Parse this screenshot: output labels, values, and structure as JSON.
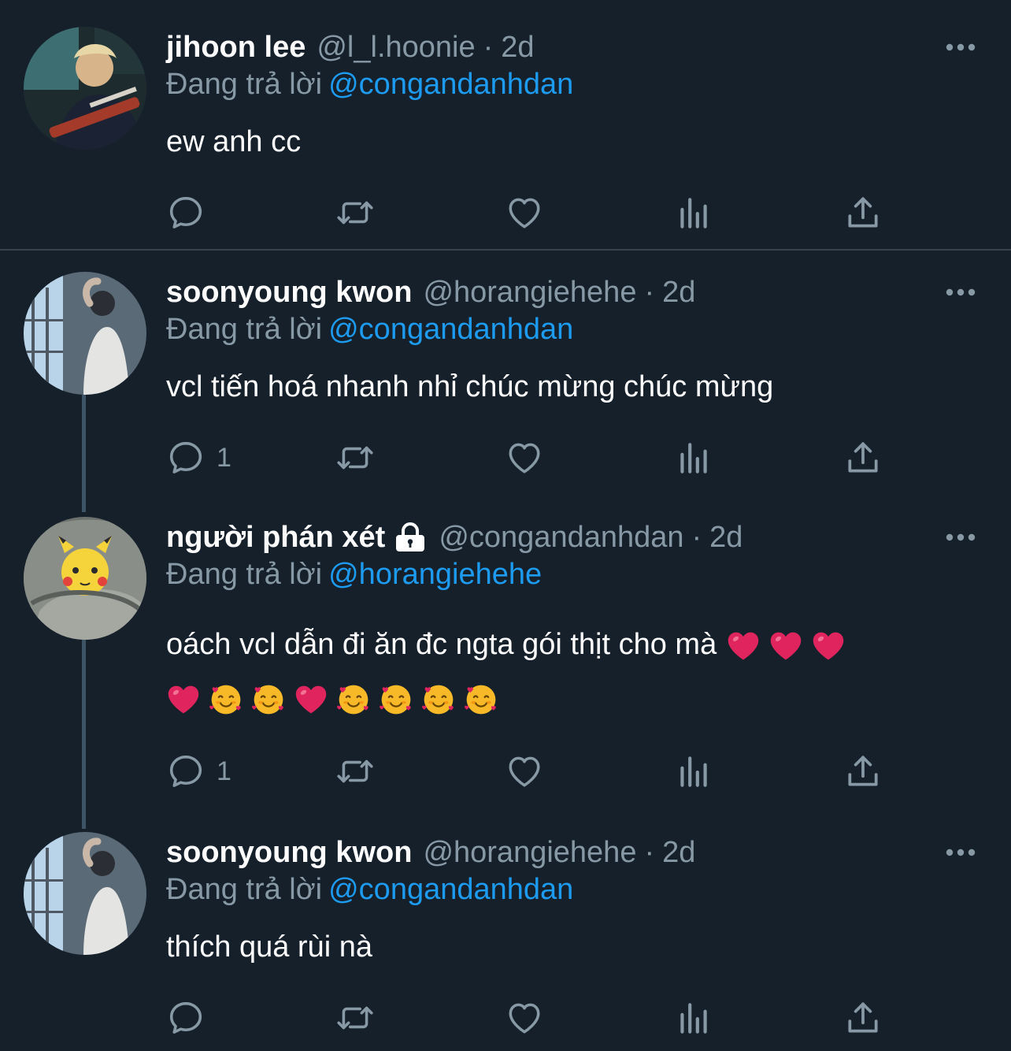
{
  "colors": {
    "background": "#15202b",
    "secondary_text": "#8899a6",
    "mention": "#1d9bf0",
    "heart_emoji": "#e0245e",
    "smile_emoji": "#f7b928"
  },
  "tweets": [
    {
      "name": "jihoon lee",
      "handle": "@l_l.hoonie",
      "dot": "·",
      "time": "2d",
      "reply_prefix": "Đang trả lời",
      "reply_to": "@congandanhdan",
      "text": "ew anh cc",
      "reply_count": "",
      "icons": [
        "reply-icon",
        "retweet-icon",
        "like-icon",
        "analytics-icon",
        "share-icon"
      ]
    },
    {
      "name": "soonyoung kwon",
      "handle": "@horangiehehe",
      "dot": "·",
      "time": "2d",
      "reply_prefix": "Đang trả lời",
      "reply_to": "@congandanhdan",
      "text": "vcl tiến hoá nhanh nhỉ chúc mừng chúc mừng",
      "reply_count": "1",
      "icons": [
        "reply-icon",
        "retweet-icon",
        "like-icon",
        "analytics-icon",
        "share-icon"
      ]
    },
    {
      "name": "người phán xét",
      "protected_icon": "lock-icon",
      "handle": "@congandanhdan",
      "dot": "·",
      "time": "2d",
      "reply_prefix": "Đang trả lời",
      "reply_to": "@horangiehehe",
      "text": "oách vcl dẫn đi ăn đc ngta gói thịt cho mà",
      "emoji_line1": [
        "red-heart-emoji",
        "red-heart-emoji",
        "red-heart-emoji"
      ],
      "emoji_line2": [
        "red-heart-emoji",
        "smiling-face-with-hearts-emoji",
        "smiling-face-with-hearts-emoji",
        "red-heart-emoji",
        "smiling-face-with-hearts-emoji",
        "smiling-face-with-hearts-emoji",
        "smiling-face-with-hearts-emoji",
        "smiling-face-with-hearts-emoji"
      ],
      "reply_count": "1",
      "icons": [
        "reply-icon",
        "retweet-icon",
        "like-icon",
        "analytics-icon",
        "share-icon"
      ]
    },
    {
      "name": "soonyoung kwon",
      "handle": "@horangiehehe",
      "dot": "·",
      "time": "2d",
      "reply_prefix": "Đang trả lời",
      "reply_to": "@congandanhdan",
      "text": "thích quá rùi nà",
      "reply_count": "",
      "icons": [
        "reply-icon",
        "retweet-icon",
        "like-icon",
        "analytics-icon",
        "share-icon"
      ]
    }
  ]
}
